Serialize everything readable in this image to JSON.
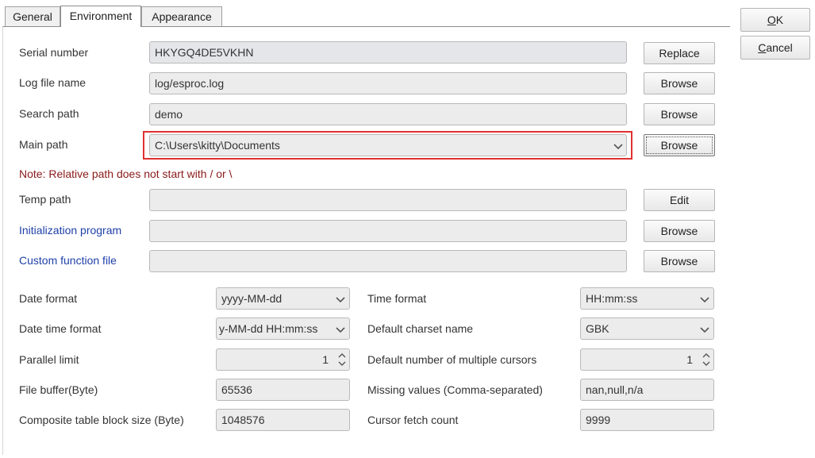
{
  "tabs": [
    "General",
    "Environment",
    "Appearance"
  ],
  "actions": {
    "ok": "OK",
    "cancel": "Cancel"
  },
  "fields": {
    "serial_number": {
      "label": "Serial number",
      "value": "HKYGQ4DE5VKHN",
      "button": "Replace"
    },
    "log_file": {
      "label": "Log file name",
      "value": "log/esproc.log",
      "button": "Browse"
    },
    "search_path": {
      "label": "Search path",
      "value": "demo",
      "button": "Browse"
    },
    "main_path": {
      "label": "Main path",
      "value": "C:\\Users\\kitty\\Documents",
      "button": "Browse"
    },
    "note": "Note: Relative path does not start with / or \\",
    "temp_path": {
      "label": "Temp path",
      "value": "",
      "button": "Edit"
    },
    "init_program": {
      "label": "Initialization program",
      "value": "",
      "button": "Browse"
    },
    "custom_function": {
      "label": "Custom function file",
      "value": "",
      "button": "Browse"
    }
  },
  "settings": {
    "date_format": {
      "label": "Date format",
      "value": "yyyy-MM-dd"
    },
    "time_format": {
      "label": "Time format",
      "value": "HH:mm:ss"
    },
    "date_time_format": {
      "label": "Date time format",
      "value": "y-MM-dd HH:mm:ss"
    },
    "charset": {
      "label": "Default charset name",
      "value": "GBK"
    },
    "parallel_limit": {
      "label": "Parallel limit",
      "value": "1"
    },
    "multi_cursors": {
      "label": "Default number of multiple cursors",
      "value": "1"
    },
    "file_buffer": {
      "label": "File buffer(Byte)",
      "value": "65536"
    },
    "missing_values": {
      "label": "Missing values (Comma-separated)",
      "value": "nan,null,n/a"
    },
    "block_size": {
      "label": "Composite table block size (Byte)",
      "value": "1048576"
    },
    "cursor_fetch": {
      "label": "Cursor fetch count",
      "value": "9999"
    }
  },
  "colors": {
    "highlight": "#e03030",
    "link_label": "#1f3fa8",
    "note": "#8b1a1a"
  },
  "icons": [
    "chevron-down-icon",
    "spinner-icon"
  ]
}
